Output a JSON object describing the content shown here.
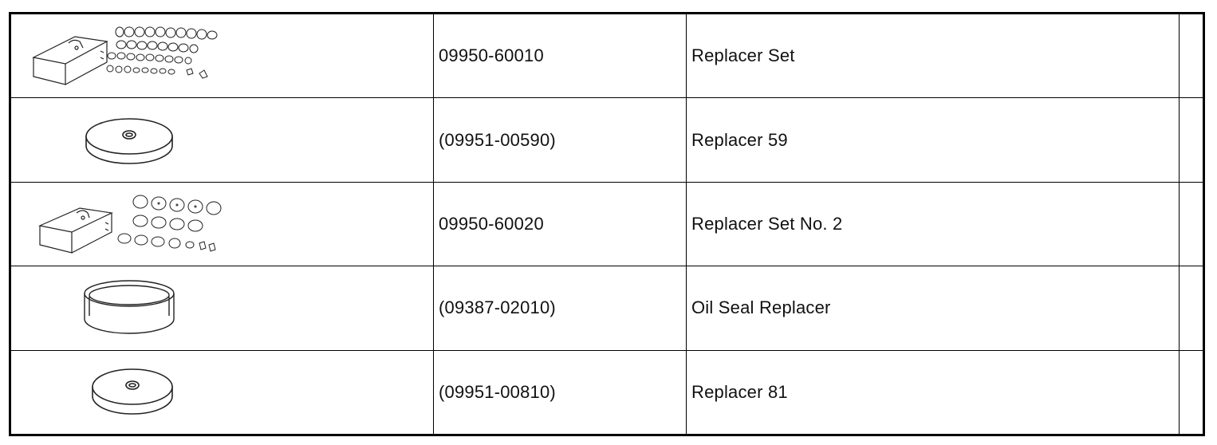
{
  "rows": [
    {
      "part_no": "09950-60010",
      "name": "Replacer Set",
      "icon": "replacer-set-case-icon"
    },
    {
      "part_no": "(09951-00590)",
      "name": "Replacer 59",
      "icon": "replacer-disc-icon"
    },
    {
      "part_no": "09950-60020",
      "name": "Replacer Set No. 2",
      "icon": "replacer-set-no2-case-icon"
    },
    {
      "part_no": "(09387-02010)",
      "name": "Oil Seal Replacer",
      "icon": "oil-seal-ring-icon"
    },
    {
      "part_no": "(09951-00810)",
      "name": "Replacer 81",
      "icon": "replacer-disc-icon"
    }
  ]
}
